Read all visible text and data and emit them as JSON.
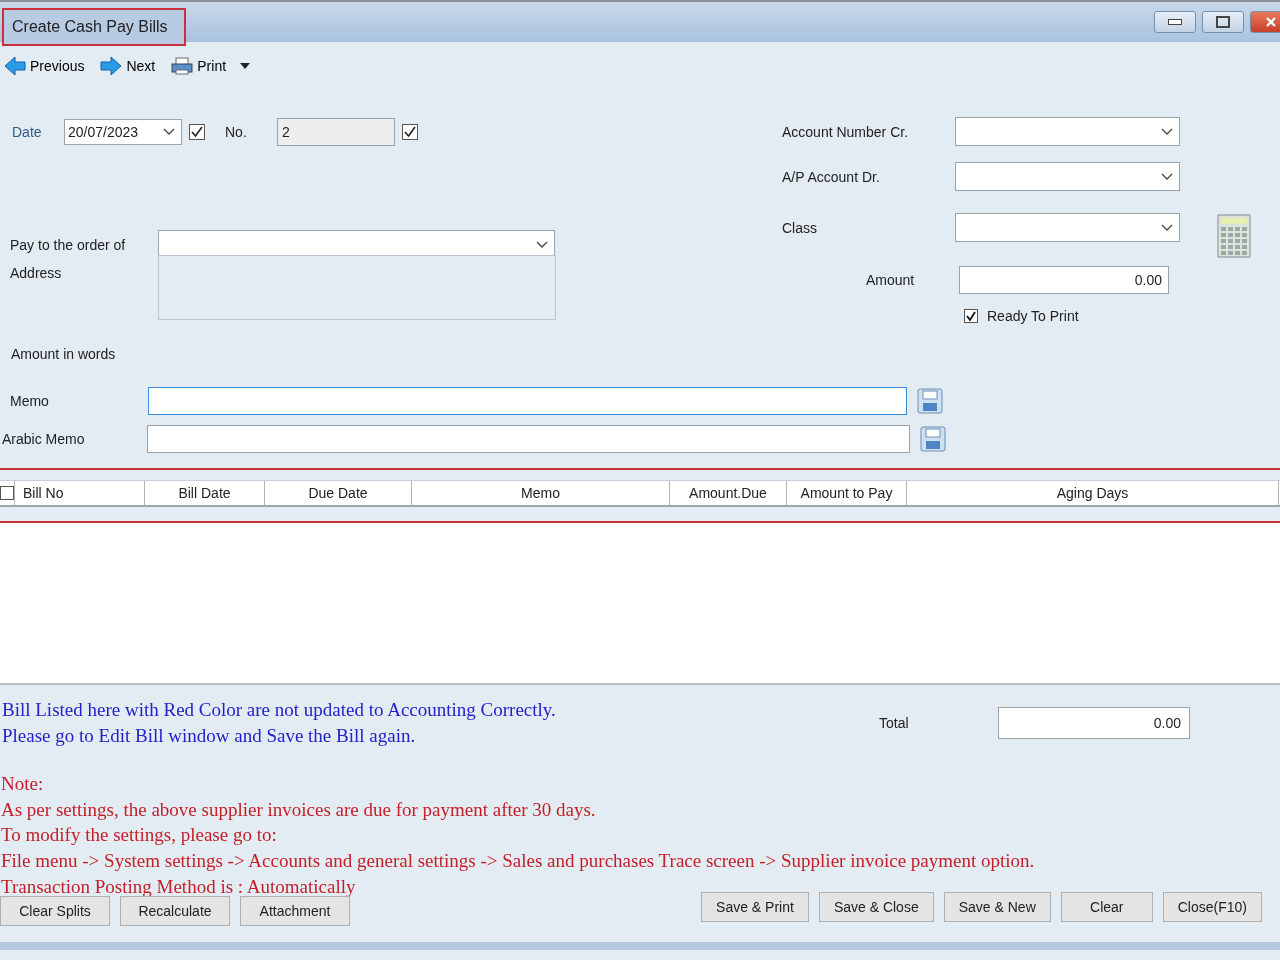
{
  "window": {
    "title": "Create Cash Pay Bills"
  },
  "toolbar": [
    {
      "label": "Previous",
      "kind": "prev"
    },
    {
      "label": "Next",
      "kind": "next"
    },
    {
      "label": "Print",
      "kind": "print"
    }
  ],
  "form": {
    "date": {
      "label": "Date",
      "value": "20/07/2023",
      "checked": true
    },
    "number": {
      "label": "No.",
      "value": "2",
      "checked": true
    },
    "pay_to": {
      "label": "Pay to the order of"
    },
    "address": {
      "label": "Address"
    },
    "amount_in_words": {
      "label": "Amount in words"
    },
    "account_cr": {
      "label": "Account Number Cr."
    },
    "ap_account": {
      "label": "A/P Account Dr."
    },
    "class": {
      "label": "Class"
    },
    "amount": {
      "label": "Amount",
      "value": "0.00"
    },
    "ready_to_print": {
      "label": "Ready To Print",
      "checked": true
    },
    "memo": {
      "label": "Memo"
    },
    "arabic_memo": {
      "label": "Arabic Memo"
    }
  },
  "table": {
    "select_all_checked": false,
    "columns": [
      "Bill No",
      "Bill Date",
      "Due Date",
      "Memo",
      "Amount.Due",
      "Amount to Pay",
      "Aging Days"
    ]
  },
  "messages": [
    "Bill Listed here with Red Color are not updated to Accounting Correctly.",
    "Please go to Edit Bill window and Save the Bill again."
  ],
  "total": {
    "label": "Total",
    "value": "0.00"
  },
  "notes": [
    "Note:",
    "As per settings, the above supplier invoices are due for payment after 30 days.",
    "To modify the settings, please go to:",
    "File menu -> System settings -> Accounts and general settings  -> Sales and purchases Trace screen -> Supplier invoice payment option.",
    "Transaction Posting Method is : Automatically"
  ],
  "left_buttons": [
    "Clear Splits",
    "Recalculate",
    "Attachment"
  ],
  "right_buttons": [
    "Save & Print",
    "Save & Close",
    "Save & New",
    "Clear",
    "Close(F10)"
  ]
}
